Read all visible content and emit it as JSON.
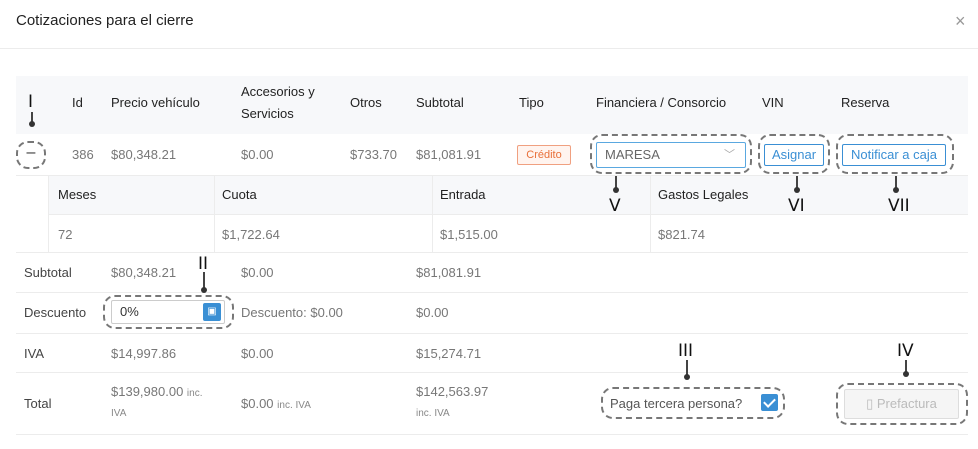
{
  "modal": {
    "title": "Cotizaciones para el cierre",
    "close_icon": "×"
  },
  "table": {
    "headers": {
      "id": "Id",
      "precio": "Precio vehículo",
      "accesorios_1": "Accesorios y",
      "accesorios_2": "Servicios",
      "otros": "Otros",
      "subtotal": "Subtotal",
      "tipo": "Tipo",
      "financiera": "Financiera / Consorcio",
      "vin": "VIN",
      "reserva": "Reserva"
    },
    "row": {
      "toggle": "–",
      "id": "386",
      "precio": "$80,348.21",
      "accesorios": "$0.00",
      "otros": "$733.70",
      "subtotal": "$81,081.91",
      "tipo": "Crédito",
      "financiera": "MARESA",
      "vin_button": "Asignar",
      "reserva_button": "Notificar a caja"
    },
    "subtable": {
      "headers": {
        "meses": "Meses",
        "cuota": "Cuota",
        "entrada": "Entrada",
        "gastos": "Gastos Legales"
      },
      "row": {
        "meses": "72",
        "cuota": "$1,722.64",
        "entrada": "$1,515.00",
        "gastos": "$821.74"
      }
    }
  },
  "summary": {
    "subtotal": {
      "label": "Subtotal",
      "precio": "$80,348.21",
      "accesorios": "$0.00",
      "total": "$81,081.91"
    },
    "descuento": {
      "label": "Descuento",
      "value": "0%",
      "text": "Descuento: $0.00",
      "total": "$0.00"
    },
    "iva": {
      "label": "IVA",
      "precio": "$14,997.86",
      "accesorios": "$0.00",
      "total": "$15,274.71"
    },
    "total": {
      "label": "Total",
      "precio": "$139,980.00",
      "precio_suffix": "inc.",
      "precio_suffix2": "IVA",
      "accesorios": "$0.00",
      "accesorios_suffix": "inc. IVA",
      "total": "$142,563.97",
      "total_suffix": "inc. IVA"
    },
    "tercera_persona": "Paga tercera persona?",
    "prefactura": "Prefactura"
  },
  "annotations": {
    "I": "I",
    "II": "II",
    "III": "III",
    "IV": "IV",
    "V": "V",
    "VI": "VI",
    "VII": "VII"
  },
  "colors": {
    "accent": "#3a8fd4",
    "badge": "#e8703a"
  }
}
